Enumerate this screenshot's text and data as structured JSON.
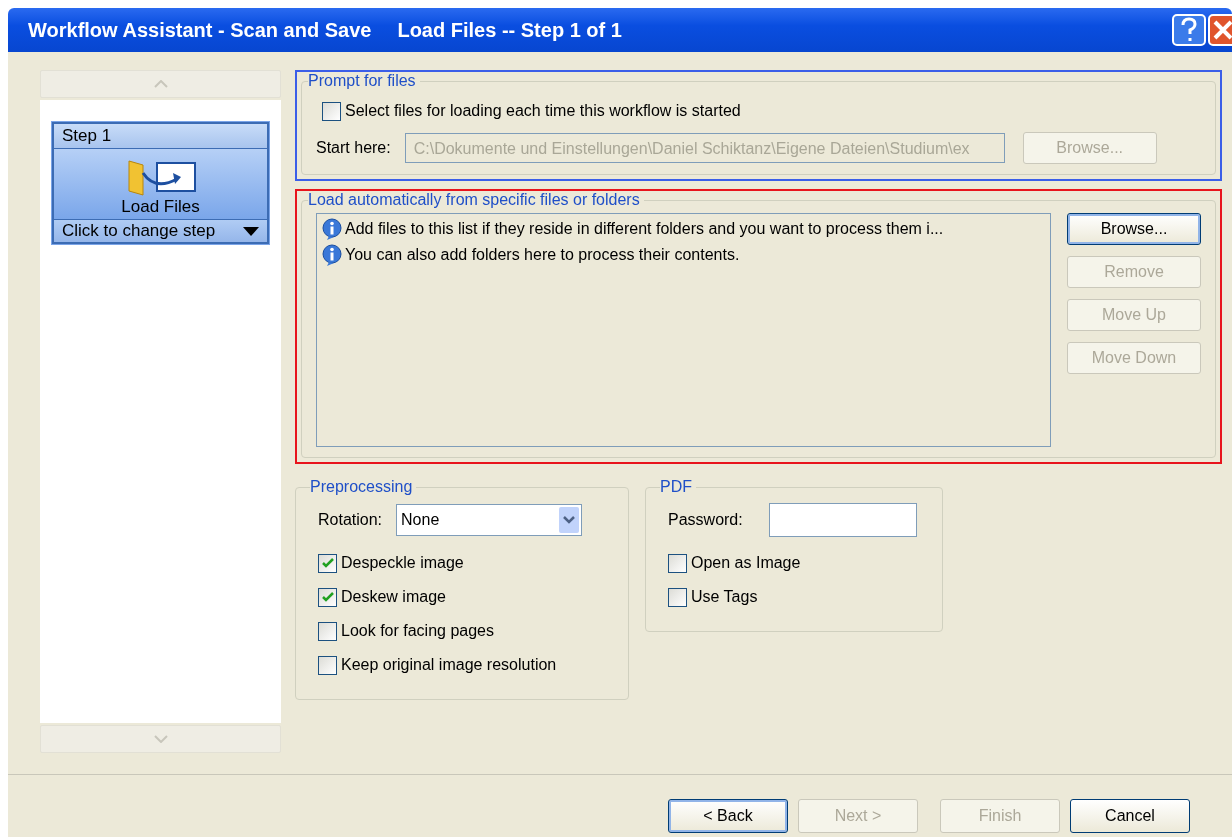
{
  "window": {
    "title": "Workflow Assistant - Scan and Save",
    "subtitle": "Load Files -- Step 1 of 1"
  },
  "steps": [
    {
      "header": "Step 1",
      "label": "Load Files",
      "footer": "Click to change step",
      "selected": true
    }
  ],
  "prompt_section": {
    "title": "Prompt for files",
    "checkbox": {
      "label": "Select files for loading each time this workflow is started",
      "checked": false
    },
    "start_label": "Start here:",
    "start_value": "C:\\Dokumente und Einstellungen\\Daniel Schiktanz\\Eigene Dateien\\Studium\\ex",
    "start_disabled": true,
    "browse": {
      "label": "Browse...",
      "disabled": true
    }
  },
  "load_section": {
    "title": "Load automatically from specific files or folders",
    "items": [
      "Add files to this list if they reside in different folders and you want to process them i...",
      "You can also add folders here to process their contents."
    ],
    "buttons": [
      {
        "label": "Browse...",
        "disabled": false
      },
      {
        "label": "Remove",
        "disabled": true
      },
      {
        "label": "Move Up",
        "disabled": true
      },
      {
        "label": "Move Down",
        "disabled": true
      }
    ]
  },
  "preprocessing": {
    "title": "Preprocessing",
    "rotation_label": "Rotation:",
    "rotation_value": "None",
    "options": [
      {
        "label": "Despeckle image",
        "checked": true
      },
      {
        "label": "Deskew image",
        "checked": true
      },
      {
        "label": "Look for facing pages",
        "checked": false
      },
      {
        "label": "Keep original image resolution",
        "checked": false
      }
    ]
  },
  "pdf": {
    "title": "PDF",
    "password_label": "Password:",
    "options": [
      {
        "label": "Open as Image",
        "checked": false
      },
      {
        "label": "Use Tags",
        "checked": false
      }
    ]
  },
  "buttons": [
    {
      "label": "< Back",
      "disabled": false
    },
    {
      "label": "Next >",
      "disabled": true
    },
    {
      "label": "Finish",
      "disabled": true
    },
    {
      "label": "Cancel",
      "disabled": false
    }
  ]
}
